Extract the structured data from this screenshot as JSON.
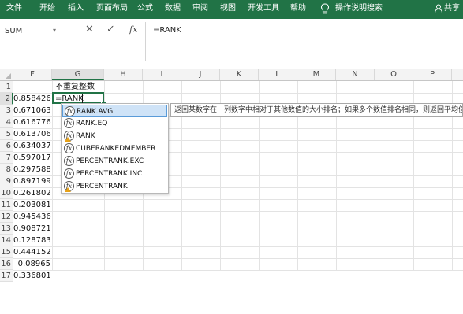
{
  "ribbon": {
    "tabs": [
      "文件",
      "开始",
      "插入",
      "页面布局",
      "公式",
      "数据",
      "审阅",
      "视图",
      "开发工具",
      "帮助"
    ],
    "search_label": "操作说明搜索",
    "share_label": "共享",
    "color": "#217346"
  },
  "formula_bar": {
    "name_box": "SUM",
    "cancel_symbol": "✕",
    "enter_symbol": "✓",
    "fx_label": "fx",
    "formula": "=RANK"
  },
  "sheet": {
    "columns": [
      "F",
      "G",
      "H",
      "I",
      "J",
      "K",
      "L",
      "M",
      "N",
      "O",
      "P"
    ],
    "rows": [
      "1",
      "2",
      "3",
      "4",
      "5",
      "6",
      "7",
      "8",
      "9",
      "10",
      "11",
      "12",
      "13",
      "14",
      "15",
      "16",
      "17"
    ],
    "g1_header": "不重复整数",
    "g2_value": "=RANK",
    "f_values": [
      "0.858426",
      "0.671063",
      "0.616776",
      "0.613706",
      "0.634037",
      "0.597017",
      "0.297588",
      "0.897199",
      "0.261802",
      "0.203081",
      "0.945436",
      "0.908721",
      "0.128783",
      "0.444152",
      "0.08965",
      "0.336801"
    ]
  },
  "autocomplete": {
    "items": [
      {
        "label": "RANK.AVG",
        "icon": "function-icon",
        "selected": true
      },
      {
        "label": "RANK.EQ",
        "icon": "function-icon",
        "selected": false
      },
      {
        "label": "RANK",
        "icon": "function-warning-icon",
        "selected": false
      },
      {
        "label": "CUBERANKEDMEMBER",
        "icon": "function-icon",
        "selected": false
      },
      {
        "label": "PERCENTRANK.EXC",
        "icon": "function-icon",
        "selected": false
      },
      {
        "label": "PERCENTRANK.INC",
        "icon": "function-icon",
        "selected": false
      },
      {
        "label": "PERCENTRANK",
        "icon": "function-warning-icon",
        "selected": false
      }
    ],
    "icon_letter": "fx",
    "tooltip": "返回某数字在一列数字中相对于其他数值的大小排名；如果多个数值排名相同，则返回平均值排名"
  }
}
